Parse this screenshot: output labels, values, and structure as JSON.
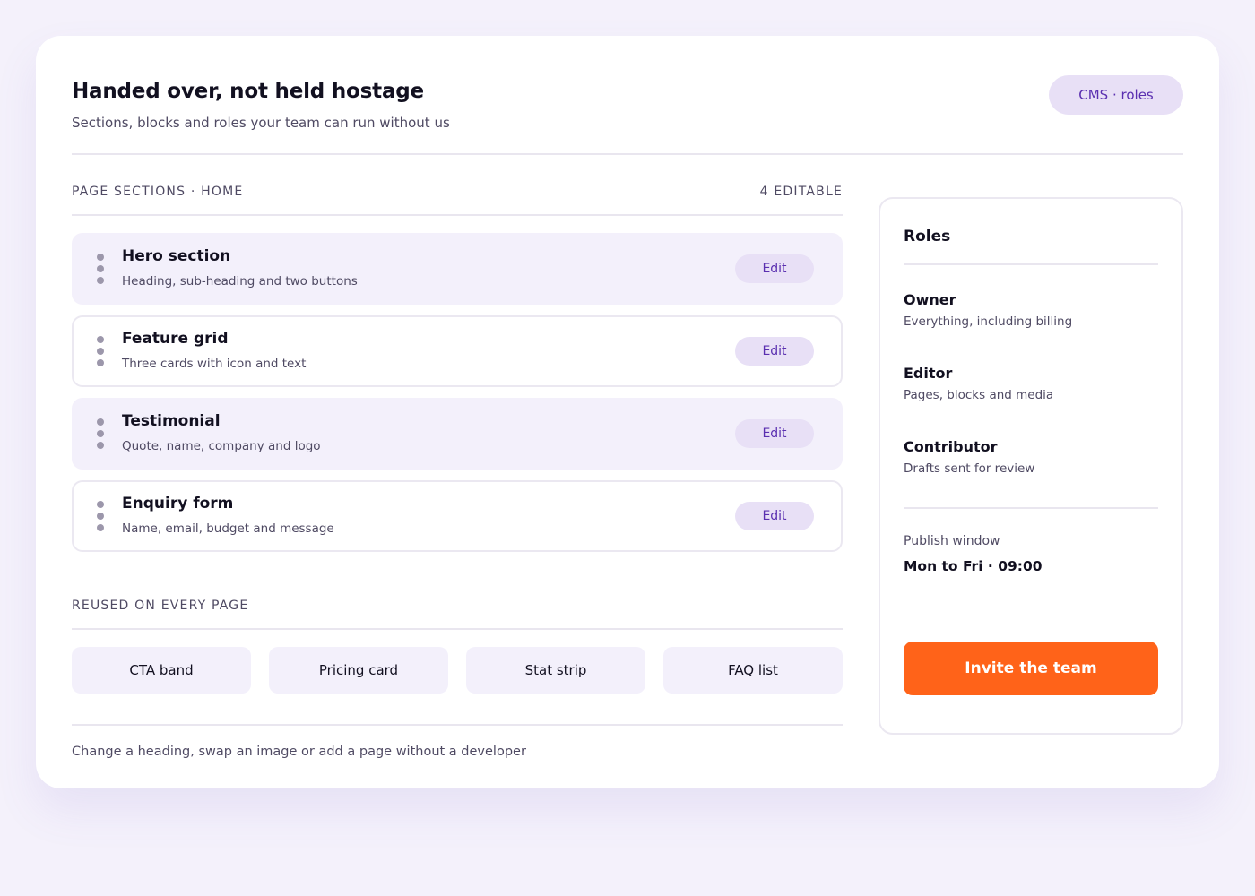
{
  "header": {
    "title": "Handed over, not held hostage",
    "subtitle": "Sections, blocks and roles your team can run without us",
    "badge": "CMS · roles"
  },
  "sections": {
    "heading": "PAGE SECTIONS · HOME",
    "count": "4 EDITABLE",
    "items": [
      {
        "title": "Hero section",
        "description": "Heading, sub-heading and two buttons",
        "action": "Edit"
      },
      {
        "title": "Feature grid",
        "description": "Three cards with icon and text",
        "action": "Edit"
      },
      {
        "title": "Testimonial",
        "description": "Quote, name, company and logo",
        "action": "Edit"
      },
      {
        "title": "Enquiry form",
        "description": "Name, email, budget and message",
        "action": "Edit"
      }
    ]
  },
  "reused": {
    "heading": "REUSED ON EVERY PAGE",
    "blocks": [
      "CTA band",
      "Pricing card",
      "Stat strip",
      "FAQ list"
    ]
  },
  "footnote": "Change a heading, swap an image or add a page without a developer",
  "roles": {
    "title": "Roles",
    "items": [
      {
        "name": "Owner",
        "description": "Everything, including billing"
      },
      {
        "name": "Editor",
        "description": "Pages, blocks and media"
      },
      {
        "name": "Contributor",
        "description": "Drafts sent for review"
      }
    ],
    "publish_label": "Publish window",
    "publish_value": "Mon to Fri · 09:00",
    "invite_label": "Invite the team"
  },
  "colors": {
    "accent": "#ff6319",
    "purple": "#5a2fb0",
    "pill_bg": "#e8e0f6",
    "row_bg": "#f3f0fb"
  }
}
